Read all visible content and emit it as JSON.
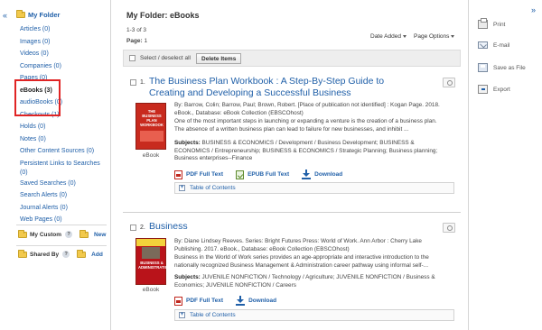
{
  "sidebar": {
    "collapse_glyph": "«",
    "root_label": "My Folder",
    "items": [
      {
        "label": "Articles (0)",
        "active": false
      },
      {
        "label": "Images (0)",
        "active": false
      },
      {
        "label": "Videos (0)",
        "active": false
      },
      {
        "label": "Companies (0)",
        "active": false
      },
      {
        "label": "Pages (0)",
        "active": false
      },
      {
        "label": "eBooks (3)",
        "active": true
      },
      {
        "label": "audioBooks (0)",
        "active": false
      },
      {
        "label": "Checkouts (1)",
        "active": false
      },
      {
        "label": "Holds (0)",
        "active": false
      },
      {
        "label": "Notes (0)",
        "active": false
      },
      {
        "label": "Other Content Sources (0)",
        "active": false
      },
      {
        "label": "Persistent Links to Searches (0)",
        "active": false
      },
      {
        "label": "Saved Searches (0)",
        "active": false
      },
      {
        "label": "Search Alerts (0)",
        "active": false
      },
      {
        "label": "Journal Alerts (0)",
        "active": false
      },
      {
        "label": "Web Pages (0)",
        "active": false
      }
    ],
    "my_custom": {
      "title": "My Custom",
      "help": "?",
      "action": "New"
    },
    "shared_by": {
      "title": "Shared By",
      "help": "?",
      "action": "Add"
    }
  },
  "main": {
    "title": "My Folder: eBooks",
    "count": "1-3 of 3",
    "page_label": "Page:",
    "page_num": "1",
    "sort_label": "Date Added",
    "page_options_label": "Page Options",
    "select_all_label": "Select / deselect all",
    "delete_label": "Delete Items",
    "results": [
      {
        "num": "1.",
        "title": "The Business Plan Workbook : A Step-By-Step Guide to Creating and Developing a Successful Business",
        "cover_text": "THE BUSINESS PLAN WORKBOOK",
        "type_label": "eBook",
        "meta_line": "By: Barrow, Colin; Barrow, Paul; Brown, Robert. [Place of publication not identified] : Kogan Page. 2018. eBook., Database: eBook Collection (EBSCOhost)",
        "description": "One of the most important steps in launching or expanding a venture is the creation of a business plan. The absence of a written business plan can lead to failure for new businesses, and inhibit ...",
        "subjects_label": "Subjects:",
        "subjects": "BUSINESS & ECONOMICS / Development / Business Development; BUSINESS & ECONOMICS / Entrepreneurship; BUSINESS & ECONOMICS / Strategic Planning; Business planning; Business enterprises--Finance",
        "pdf_label": "PDF Full Text",
        "epub_label": "EPUB Full Text",
        "download_label": "Download",
        "toc_label": "Table of Contents"
      },
      {
        "num": "2.",
        "title": "Business",
        "cover_text": "BUSINESS & ADMINISTRATION",
        "type_label": "eBook",
        "meta_line": "By: Diane Lindsey Reeves. Series: Bright Futures Press: World of Work. Ann Arbor : Cherry Lake Publishing. 2017. eBook., Database: eBook Collection (EBSCOhost)",
        "description": "Business in the World of Work series provides an age-appropriate and interactive introduction to the nationally recognized Business Management & Administration career pathway using informal self-...",
        "subjects_label": "Subjects:",
        "subjects": "JUVENILE NONFICTION / Technology / Agriculture; JUVENILE NONFICTION / Business & Economics; JUVENILE NONFICTION / Careers",
        "pdf_label": "PDF Full Text",
        "download_label": "Download",
        "toc_label": "Table of Contents"
      }
    ]
  },
  "tools": {
    "collapse_glyph": "»",
    "items": [
      {
        "label": "Print",
        "icon": "print-icon"
      },
      {
        "label": "E-mail",
        "icon": "email-icon"
      },
      {
        "label": "Save as File",
        "icon": "save-icon"
      },
      {
        "label": "Export",
        "icon": "export-icon"
      }
    ]
  },
  "colors": {
    "link": "#1f5fa8",
    "highlight": "#e02424",
    "toolbar_bg": "#eeeeee"
  }
}
